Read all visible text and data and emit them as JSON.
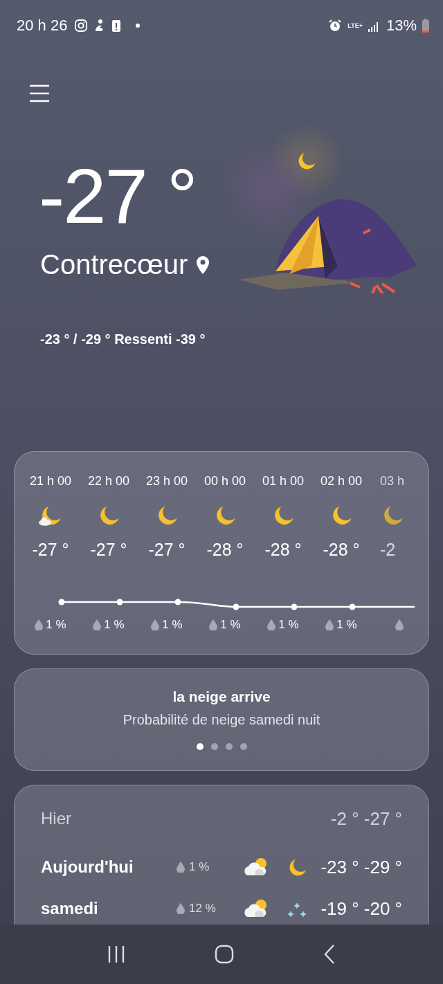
{
  "status_bar": {
    "time": "20 h 26",
    "network": "LTE+",
    "battery": "13%"
  },
  "current": {
    "temperature": "-27 °",
    "location": "Contrecœur",
    "range": "-23 ° / -29 ° Ressenti -39 °"
  },
  "hourly": [
    {
      "time": "21 h 00",
      "kind": "moon-cloud",
      "temperature": "-27 °",
      "precip": "1 %"
    },
    {
      "time": "22 h 00",
      "kind": "moon",
      "temperature": "-27 °",
      "precip": "1 %"
    },
    {
      "time": "23 h 00",
      "kind": "moon",
      "temperature": "-27 °",
      "precip": "1 %"
    },
    {
      "time": "00 h 00",
      "kind": "moon",
      "temperature": "-28 °",
      "precip": "1 %"
    },
    {
      "time": "01 h 00",
      "kind": "moon",
      "temperature": "-28 °",
      "precip": "1 %"
    },
    {
      "time": "02 h 00",
      "kind": "moon",
      "temperature": "-28 °",
      "precip": "1 %"
    },
    {
      "time": "03 h",
      "kind": "moon",
      "temperature": "-2"
    }
  ],
  "alert": {
    "title": "la neige arrive",
    "text": "Probabilité de neige samedi nuit",
    "pages": [
      {
        "selected": true
      },
      {
        "selected": false
      },
      {
        "selected": false
      },
      {
        "selected": false
      }
    ]
  },
  "daily": [
    {
      "kind": "past",
      "day": "Hier",
      "high": "-2 °",
      "low": "-27 °"
    },
    {
      "kind": "forecast",
      "day": "Aujourd'hui",
      "precip": "1 %",
      "icons": [
        {
          "kind": "cloud-sun"
        },
        {
          "kind": "moon"
        }
      ],
      "high": "-23 °",
      "low": "-29 °"
    },
    {
      "kind": "forecast",
      "day": "samedi",
      "precip": "12 %",
      "icons": [
        {
          "kind": "cloud-sun"
        },
        {
          "kind": "snow"
        }
      ],
      "high": "-19 °",
      "low": "-20 °"
    }
  ]
}
